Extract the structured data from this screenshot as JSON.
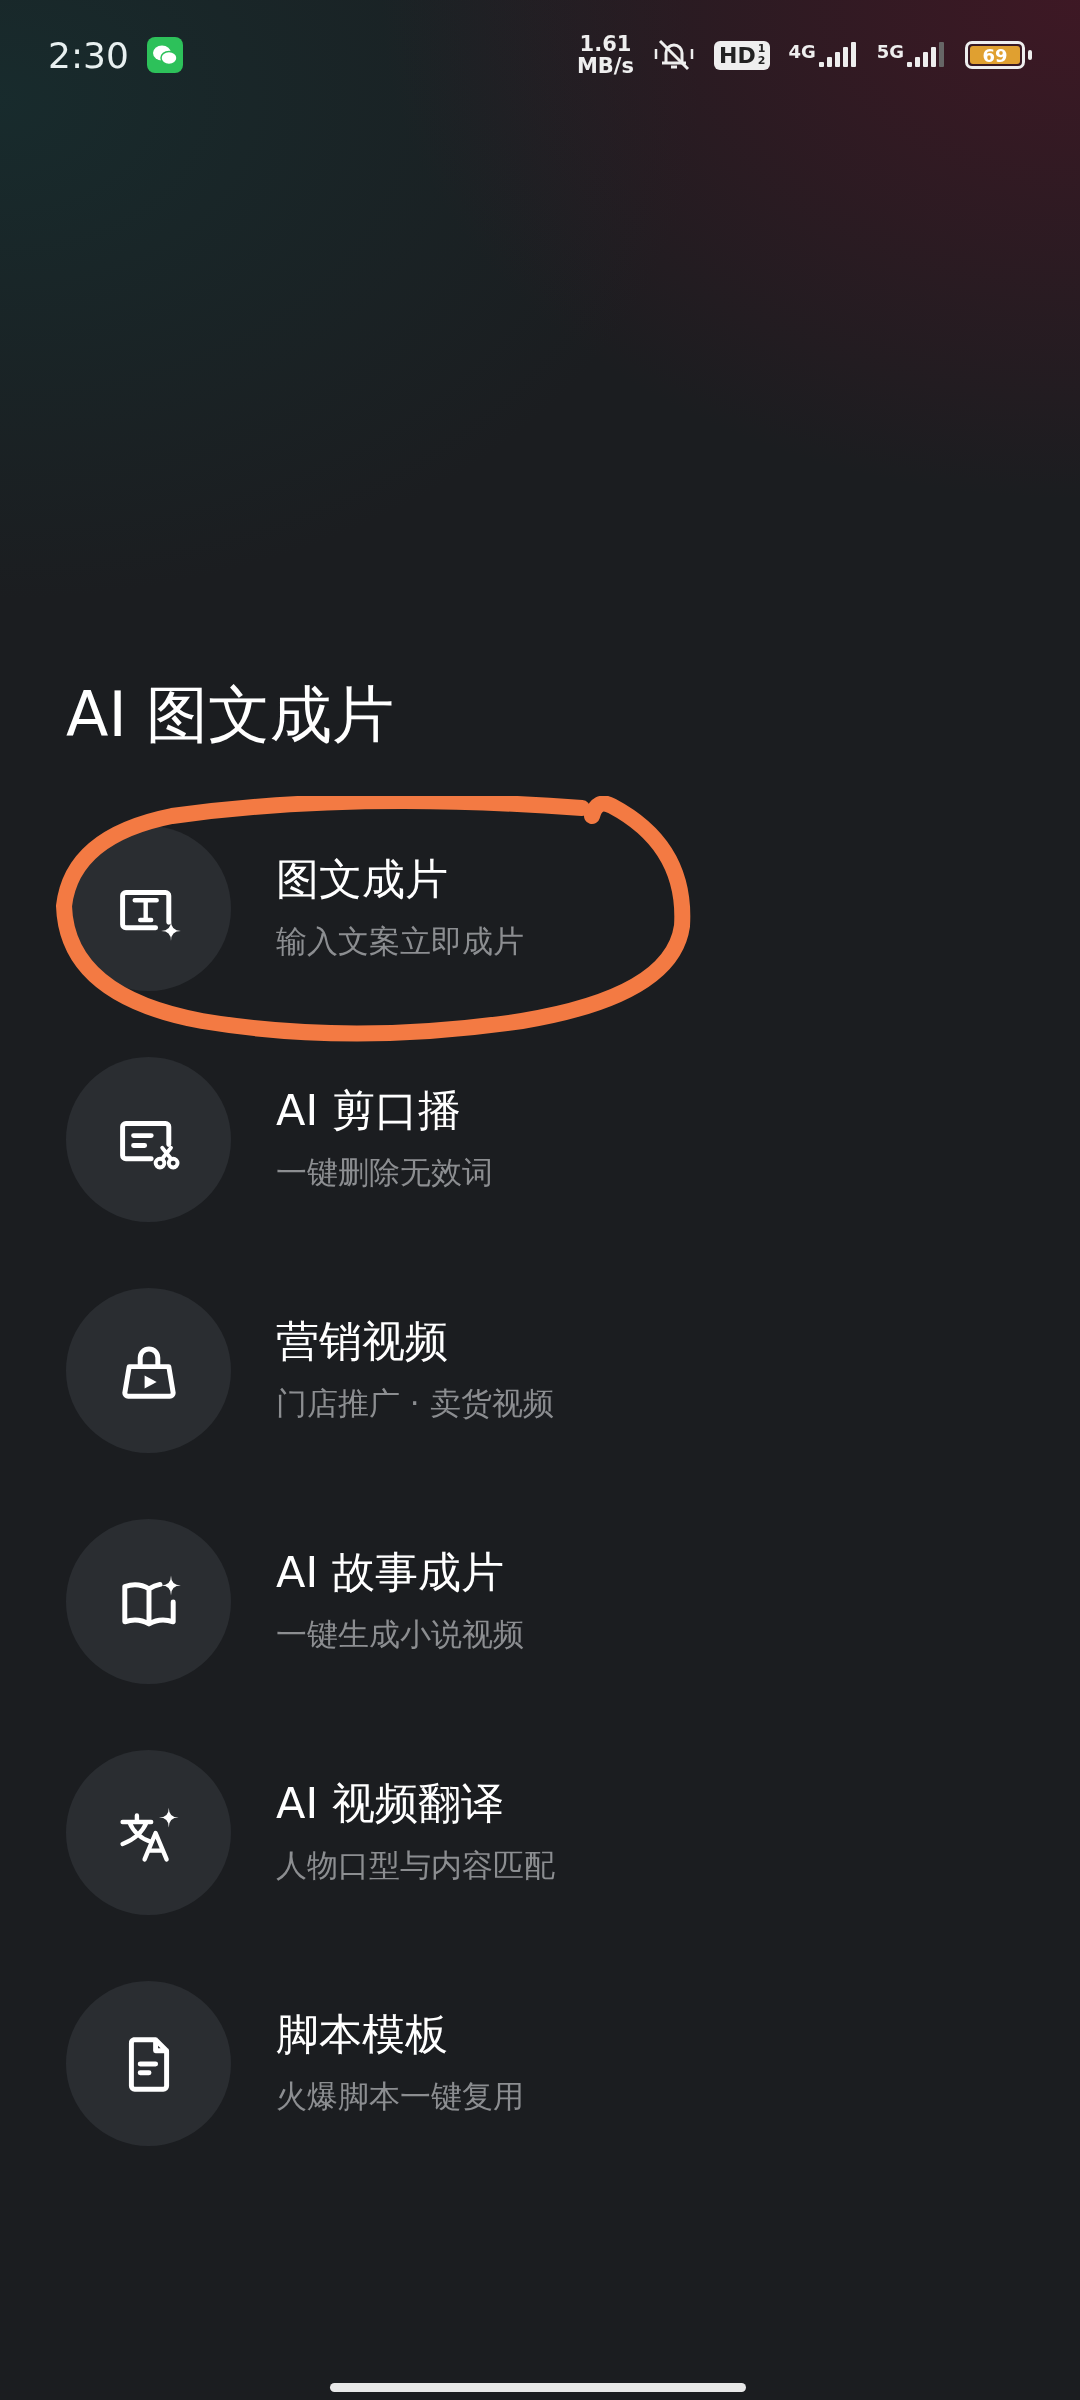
{
  "status_bar": {
    "time": "2:30",
    "net_speed": [
      "1.61",
      "MB/s"
    ],
    "hd_badge": {
      "label": "HD",
      "sub": [
        "1",
        "2"
      ]
    },
    "signals": [
      "4G",
      "5G"
    ],
    "battery": "69"
  },
  "title": "AI 图文成片",
  "items": [
    {
      "kind": "text-video",
      "title": "图文成片",
      "subtitle": "输入文案立即成片",
      "annotated": true
    },
    {
      "kind": "cut",
      "title": "AI 剪口播",
      "subtitle": "一键删除无效词",
      "annotated": false
    },
    {
      "kind": "marketing",
      "title": "营销视频",
      "subtitle": "门店推广 · 卖货视频",
      "annotated": false
    },
    {
      "kind": "story",
      "title": "AI 故事成片",
      "subtitle": "一键生成小说视频",
      "annotated": false
    },
    {
      "kind": "translate",
      "title": "AI 视频翻译",
      "subtitle": "人物口型与内容匹配",
      "annotated": false
    },
    {
      "kind": "script",
      "title": "脚本模板",
      "subtitle": "火爆脚本一键复用",
      "annotated": false
    }
  ]
}
